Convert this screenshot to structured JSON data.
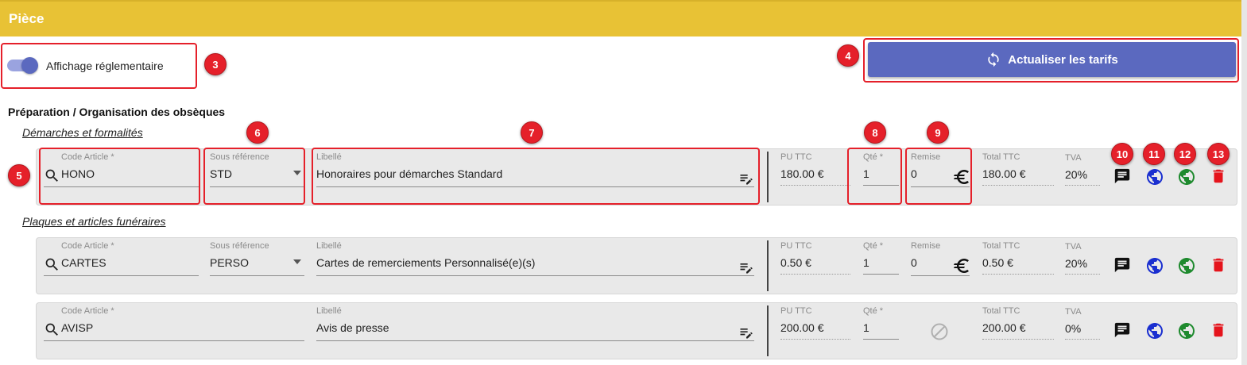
{
  "header": {
    "title": "Pièce"
  },
  "display_toggle": {
    "label": "Affichage réglementaire",
    "on": true
  },
  "refresh_button": {
    "label": "Actualiser les tarifs"
  },
  "section": {
    "title": "Préparation / Organisation des obsèques"
  },
  "field_labels": {
    "code": "Code Article *",
    "subref": "Sous référence",
    "libelle": "Libellé",
    "pu": "PU TTC",
    "qty": "Qté *",
    "remise": "Remise",
    "total": "Total TTC",
    "tva": "TVA"
  },
  "groups": [
    {
      "title": "Démarches et formalités"
    },
    {
      "title": "Plaques et articles funéraires"
    }
  ],
  "rows": [
    {
      "code": "HONO",
      "subref": "STD",
      "libelle": "Honoraires pour démarches Standard",
      "pu": "180.00 €",
      "qty": "1",
      "remise": "0",
      "total": "180.00 €",
      "tva": "20%"
    },
    {
      "code": "CARTES",
      "subref": "PERSO",
      "libelle": "Cartes de remerciements Personnalisé(e)(s)",
      "pu": "0.50 €",
      "qty": "1",
      "remise": "0",
      "total": "0.50 €",
      "tva": "20%"
    },
    {
      "code": "AVISP",
      "libelle": "Avis de presse",
      "pu": "200.00 €",
      "qty": "1",
      "total": "200.00 €",
      "tva": "0%"
    }
  ],
  "annotations": [
    "3",
    "4",
    "5",
    "6",
    "7",
    "8",
    "9",
    "10",
    "11",
    "12",
    "13"
  ],
  "colors": {
    "header": "#e8c235",
    "accent": "#5b69bf",
    "annotation": "#e5202a",
    "globe_blue": "#1a2fd0",
    "globe_green": "#1e8a2e",
    "delete": "#e5141c"
  }
}
